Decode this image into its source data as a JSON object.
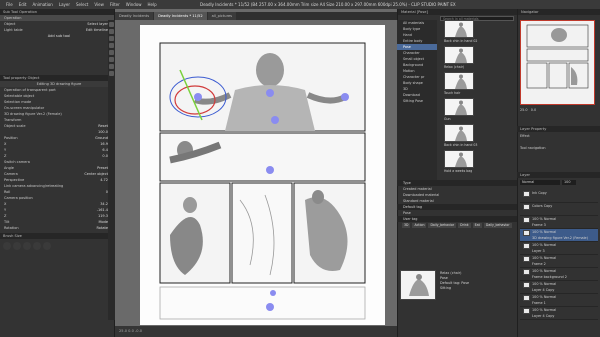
{
  "window": {
    "title": "Deadly Incidents * 11/52 (B4 257.00 x 364.00mm Trim size A4 Size 210.00 x 297.00mm 600dpi 25.0%) - CLIP STUDIO PAINT EX",
    "menu": [
      "File",
      "Edit",
      "Animation",
      "Layer",
      "Select",
      "View",
      "Filter",
      "Window",
      "Help"
    ]
  },
  "sub_tool": {
    "header": "Sub Tool Operation",
    "items": [
      "Operation",
      "Object",
      "Select layer",
      "Light table",
      "Edit timeline"
    ],
    "add_label": "Add sub tool"
  },
  "tool_property": {
    "header": "Tool property Object",
    "subheader": "Editing 3D drawing figure",
    "operation_label": "Operation of transparent part",
    "selectable_label": "Selectable object",
    "rows": [
      {
        "label": "Selection mode",
        "value": ""
      },
      {
        "label": "On-screen manipulator",
        "value": ""
      },
      {
        "label": "3D drawing figure Ver.2 (Female)",
        "value": ""
      },
      {
        "label": "Transform",
        "value": ""
      },
      {
        "label": "Object scale",
        "value": "Reset"
      },
      {
        "label": "",
        "value": "100.0"
      },
      {
        "label": "Position",
        "value": "Ground"
      },
      {
        "label": "X",
        "value": "16.9"
      },
      {
        "label": "Y",
        "value": "6.4"
      },
      {
        "label": "Z",
        "value": "0.0"
      },
      {
        "label": "Switch camera",
        "value": ""
      },
      {
        "label": "Angle",
        "value": "Preset"
      },
      {
        "label": "Camera",
        "value": "Center object"
      },
      {
        "label": "Perspective",
        "value": "4.72"
      },
      {
        "label": "Link camera advancing/retreating",
        "value": ""
      },
      {
        "label": "Roll",
        "value": "0"
      },
      {
        "label": "Camera position",
        "value": ""
      },
      {
        "label": "X",
        "value": "34.2"
      },
      {
        "label": "Y",
        "value": "-161.4"
      },
      {
        "label": "Z",
        "value": "119.3"
      },
      {
        "label": "Tilt",
        "value": "Mode"
      },
      {
        "label": "Rotation",
        "value": "Rotate"
      }
    ]
  },
  "brush_size": {
    "header": "Brush Size"
  },
  "canvas": {
    "tabs": [
      "Deadly Incidents",
      "Deadly Incidents * 11/52",
      "all_pictures"
    ],
    "active_tab": 1,
    "status": "25.0   0.0   -0.0"
  },
  "material": {
    "header": "Material [Pose]",
    "search_placeholder": "Search in all materials",
    "tree": [
      "All materials",
      "Body type",
      "Hand",
      "Entire body",
      "Pose",
      "Character",
      "Small object",
      "Background",
      "Motion",
      "Character pr",
      "Body shape",
      "3D",
      "Download",
      "Sitting Pose"
    ],
    "selected_tree": 4,
    "thumbs": [
      "Back chin in hand 02",
      "Relax (chair)",
      "Touch hair",
      "Gun",
      "Back chin in hand 03",
      "Hold a weeks bag"
    ],
    "type_label": "Type",
    "type_values": [
      "Created material",
      "Downloaded material",
      "Standard material"
    ],
    "default_tag": "Default tag",
    "tags": [
      "Pose"
    ],
    "user_tag": "User tag",
    "user_tags": [
      "3D",
      "Action",
      "Daily_behavior",
      "Drink",
      "Eat",
      "Daily_behavior"
    ],
    "preview_name": "Relax (chair)",
    "preview_info": "Pose",
    "preview_tag": "Default tag: Pose",
    "preview_text": "Sitting"
  },
  "navigator": {
    "header": "Navigator",
    "zoom": "25.0",
    "rotate": "0.0"
  },
  "layer_property": {
    "header": "Layer Property",
    "effect_label": "Effect",
    "tool_nav_label": "Tool navigation"
  },
  "layers": {
    "header": "Layer",
    "blend": "Normal",
    "opacity": "100",
    "rows": [
      {
        "name": "Ink Copy",
        "blend": ""
      },
      {
        "name": "Colors Copy",
        "blend": ""
      },
      {
        "name": "100 % Normal",
        "blend": "Frame 3"
      },
      {
        "name": "100 % Normal",
        "blend": "3D drawing figure Ver.2 (Female)"
      },
      {
        "name": "100 % Normal",
        "blend": "Layer 3"
      },
      {
        "name": "100 % Normal",
        "blend": "Frame 2"
      },
      {
        "name": "100 % Normal",
        "blend": "Frame background 2"
      },
      {
        "name": "100 % Normal",
        "blend": "Layer 4 Copy"
      },
      {
        "name": "100 % Normal",
        "blend": "Frame 1"
      },
      {
        "name": "100 % Normal",
        "blend": "Layer 4 Copy"
      }
    ],
    "selected": 3
  }
}
